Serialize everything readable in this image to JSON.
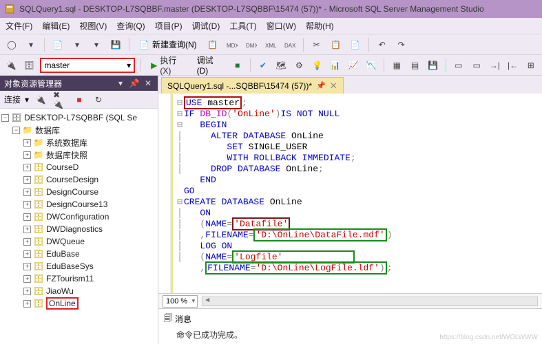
{
  "title": "SQLQuery1.sql - DESKTOP-L7SQBBF.master (DESKTOP-L7SQBBF\\15474 (57))* - Microsoft SQL Server Management Studio",
  "menu": {
    "file": "文件(F)",
    "edit": "编辑(E)",
    "view": "视图(V)",
    "query": "查询(Q)",
    "project": "项目(P)",
    "debug": "调试(D)",
    "tools": "工具(T)",
    "window": "窗口(W)",
    "help": "帮助(H)"
  },
  "toolbar": {
    "new_query": "新建查询(N)"
  },
  "toolbar2": {
    "db": "master",
    "execute": "执行(X)",
    "debug": "调试(D)"
  },
  "sidebar": {
    "title": "对象资源管理器",
    "connect": "连接",
    "server": "DESKTOP-L7SQBBF (SQL Se",
    "databases_folder": "数据库",
    "sys_db": "系统数据库",
    "snapshots": "数据库快照",
    "dbs": [
      "CourseD",
      "CourseDesign",
      "DesignCourse",
      "DesignCourse13",
      "DWConfiguration",
      "DWDiagnostics",
      "DWQueue",
      "EduBase",
      "EduBaseSys",
      "FZTourism11",
      "JiaoWu",
      "OnLine"
    ]
  },
  "tab": {
    "label": "SQLQuery1.sql -...SQBBF\\15474 (57))*"
  },
  "code": {
    "l1a": "USE",
    "l1b": " master",
    "l2a": "IF",
    "l2b": "DB_ID",
    "l2c": "'OnLine'",
    "l2d": "IS NOT NULL",
    "l3": "BEGIN",
    "l4a": "ALTER DATABASE",
    "l4b": " OnLine",
    "l5a": "SET",
    "l5b": " SINGLE_USER",
    "l6a": "WITH ROLLBACK IMMEDIATE",
    "l7a": "DROP DATABASE",
    "l7b": " OnLine",
    "l8": "END",
    "l9": "GO",
    "l10a": "CREATE DATABASE",
    "l10b": " OnLine",
    "l11": "ON",
    "l12a": "NAME",
    "l12b": "'Datafile'",
    "l13a": "FILENAME",
    "l13b": "'D:\\OnLine\\DataFile.mdf'",
    "l14": "LOG ON",
    "l15a": "NAME",
    "l15b": "'Logfile'",
    "l16a": "FILENAME",
    "l16b": "'D:\\OnLine\\LogFile.ldf'"
  },
  "zoom": "100 %",
  "messages": {
    "tab": "消息",
    "body": "命令已成功完成。"
  },
  "watermark": "https://blog.csdn.net/WOLWWW"
}
